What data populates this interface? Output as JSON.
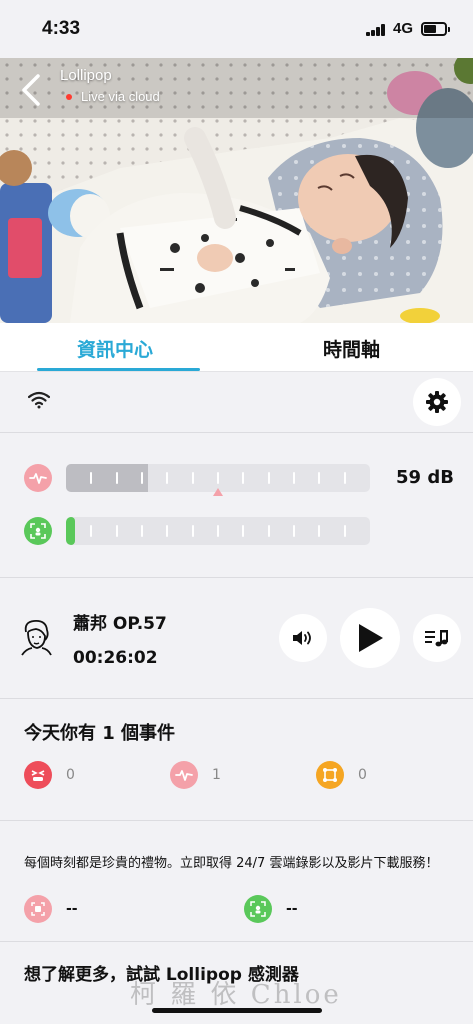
{
  "status_bar": {
    "time": "4:33",
    "network": "4G"
  },
  "camera": {
    "name": "Lollipop",
    "status": "Live via cloud"
  },
  "tabs": [
    {
      "label": "資訊中心",
      "active": true
    },
    {
      "label": "時間軸",
      "active": false
    }
  ],
  "meters": {
    "sound": {
      "value_text": "59 dB",
      "level": 0.27,
      "color": "#f4a1a9"
    },
    "motion": {
      "level": 0.03,
      "color": "#5ac85a"
    }
  },
  "music": {
    "title": "蕭邦 OP.57",
    "elapsed": "00:26:02"
  },
  "events": {
    "title": "今天你有 1 個事件",
    "items": [
      {
        "icon": "crying-face-icon",
        "count": "0",
        "color": "#ee4d5a"
      },
      {
        "icon": "sound-wave-icon",
        "count": "1",
        "color": "#f4a1a9"
      },
      {
        "icon": "crossing-zone-icon",
        "count": "0",
        "color": "#f5a623"
      }
    ]
  },
  "promo": {
    "text": "每個時刻都是珍貴的禮物。立即取得 24/7 雲端錄影以及影片下載服務！",
    "items": [
      {
        "icon": "video-recording-icon",
        "value": "--",
        "color": "#f4a1a9"
      },
      {
        "icon": "baby-monitor-icon",
        "value": "--",
        "color": "#5ac85a"
      }
    ]
  },
  "bottom": {
    "title": "想了解更多，試試 Lollipop 感測器"
  },
  "watermark": "柯 羅 依 Chloe",
  "colors": {
    "accent": "#2aa9d6"
  }
}
